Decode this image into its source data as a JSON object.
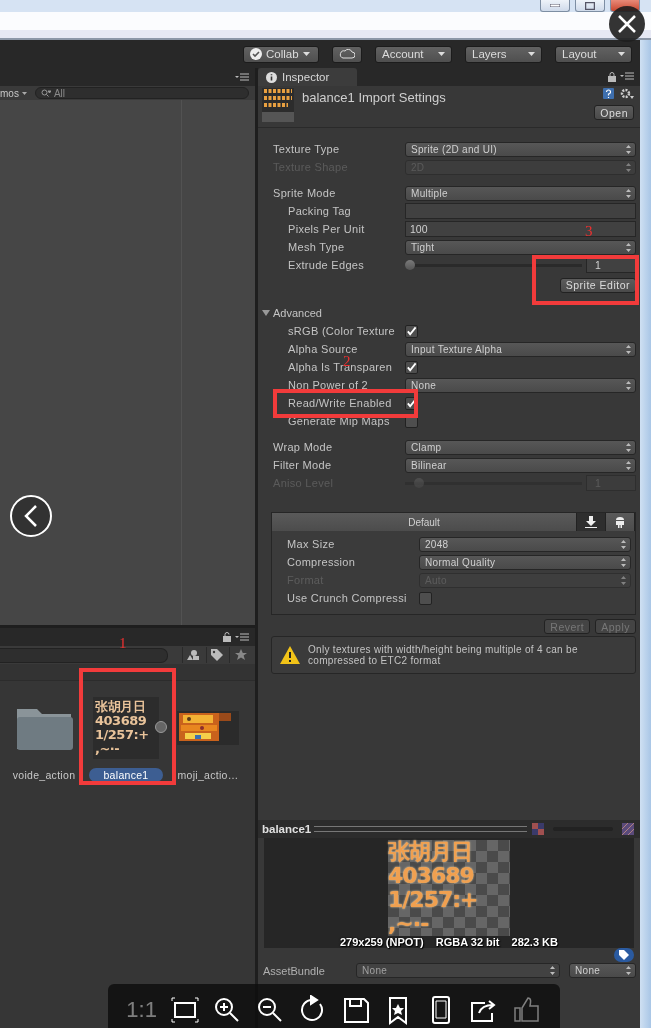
{
  "toolbar": [
    {
      "kind": "collab",
      "label": "Collab"
    },
    {
      "kind": "cloud"
    },
    {
      "kind": "dropdown",
      "label": "Account"
    },
    {
      "kind": "dropdown",
      "label": "Layers"
    },
    {
      "kind": "dropdown",
      "label": "Layout"
    }
  ],
  "scene": {
    "mode": "mos",
    "search": {
      "placeholder": "All"
    }
  },
  "inspector": {
    "tab": "Inspector",
    "title": "balance1 Import Settings",
    "open_button": "Open",
    "groups": [
      {
        "rows": [
          {
            "kind": "dropdown",
            "label": "Texture Type",
            "value": "Sprite (2D and UI)",
            "disabled": false
          },
          {
            "kind": "dropdown",
            "label": "Texture Shape",
            "value": "2D",
            "disabled": true
          }
        ]
      },
      {
        "rows": [
          {
            "kind": "dropdown",
            "label": "Sprite Mode",
            "value": "Multiple",
            "disabled": false,
            "children": [
              {
                "kind": "text",
                "label": "Packing Tag",
                "disabled": false
              },
              {
                "kind": "text",
                "label": "Pixels Per Unit",
                "value": "100",
                "disabled": false
              },
              {
                "kind": "dropdown",
                "label": "Mesh Type",
                "value": "Tight",
                "disabled": false
              },
              {
                "kind": "slider",
                "label": "Extrude Edges",
                "level": 0.03,
                "value": "1",
                "disabled": false
              },
              {
                "kind": "button",
                "label": "Sprite Editor",
                "disabled": false
              }
            ]
          }
        ]
      },
      {
        "rows": [
          {
            "kind": "foldout",
            "label": "Advanced",
            "expanded": true,
            "disabled": false,
            "children": [
              {
                "kind": "checkbox",
                "label": "sRGB (Color Texture",
                "checked": true,
                "disabled": false
              },
              {
                "kind": "dropdown",
                "label": "Alpha Source",
                "value": "Input Texture Alpha",
                "disabled": false
              },
              {
                "kind": "checkbox",
                "label": "Alpha Is Transparen",
                "checked": true,
                "disabled": false
              },
              {
                "kind": "dropdown",
                "label": "Non Power of 2",
                "value": "None",
                "disabled": false
              },
              {
                "kind": "checkbox",
                "label": "Read/Write Enabled",
                "checked": true,
                "disabled": false
              },
              {
                "kind": "checkbox",
                "label": "Generate Mip Maps",
                "checked": false,
                "disabled": false
              }
            ]
          }
        ]
      },
      {
        "rows": [
          {
            "kind": "dropdown",
            "label": "Wrap Mode",
            "value": "Clamp",
            "disabled": false
          },
          {
            "kind": "dropdown",
            "label": "Filter Mode",
            "value": "Bilinear",
            "disabled": false
          },
          {
            "kind": "slider",
            "label": "Aniso Level",
            "level": 0.08,
            "value": "1",
            "disabled": true
          }
        ]
      }
    ],
    "platform": {
      "tabs": [
        {
          "kind": "default",
          "label": "Default",
          "selected": false
        },
        {
          "kind": "download",
          "selected": true
        },
        {
          "kind": "android",
          "selected": false
        }
      ],
      "rows": [
        {
          "kind": "dropdown",
          "label": "Max Size",
          "value": "2048",
          "disabled": false
        },
        {
          "kind": "dropdown",
          "label": "Compression",
          "value": "Normal Quality",
          "disabled": false
        },
        {
          "kind": "dropdown",
          "label": "Format",
          "value": "Auto",
          "disabled": true
        },
        {
          "kind": "checkbox",
          "label": "Use Crunch Compressi",
          "checked": false,
          "disabled": false
        }
      ]
    },
    "buttons": [
      {
        "label": "Revert",
        "disabled": true
      },
      {
        "label": "Apply",
        "disabled": true
      }
    ],
    "help": {
      "kind": "warning",
      "text": "Only textures with width/height being multiple of 4 can be compressed to ETC2 format"
    }
  },
  "project": {
    "items": [
      {
        "kind": "folder",
        "name": "voide_action",
        "selected": false
      },
      {
        "kind": "texture",
        "name": "balance1",
        "selected": true,
        "glyphs": [
          "张胡月日",
          "403689",
          "1/257:+",
          ",~·-"
        ]
      },
      {
        "kind": "picture",
        "name": "moji_actio…",
        "selected": false
      }
    ]
  },
  "preview": {
    "title": "balance1",
    "glyphs": [
      "张胡月日",
      "403689",
      "1/257:+",
      ",~·-"
    ],
    "info": [
      "279x259 (NPOT)",
      "RGBA 32 bit",
      "282.3 KB"
    ]
  },
  "asset_bundle": {
    "label": "AssetBundle",
    "values": [
      "None",
      "None"
    ]
  },
  "viewer": {
    "tools": [
      {
        "kind": "actual-size",
        "label": "1:1",
        "disabled": true
      },
      {
        "kind": "fit",
        "disabled": false
      },
      {
        "kind": "zoom-in",
        "disabled": false
      },
      {
        "kind": "zoom-out",
        "disabled": false
      },
      {
        "kind": "rotate",
        "disabled": false
      },
      {
        "kind": "save",
        "disabled": false
      },
      {
        "kind": "bookmark",
        "disabled": false
      },
      {
        "kind": "tablet",
        "disabled": false
      },
      {
        "kind": "share",
        "disabled": false
      },
      {
        "kind": "like",
        "disabled": true
      }
    ]
  },
  "annotations": [
    {
      "label": "1"
    },
    {
      "label": "2"
    },
    {
      "label": "3"
    }
  ]
}
